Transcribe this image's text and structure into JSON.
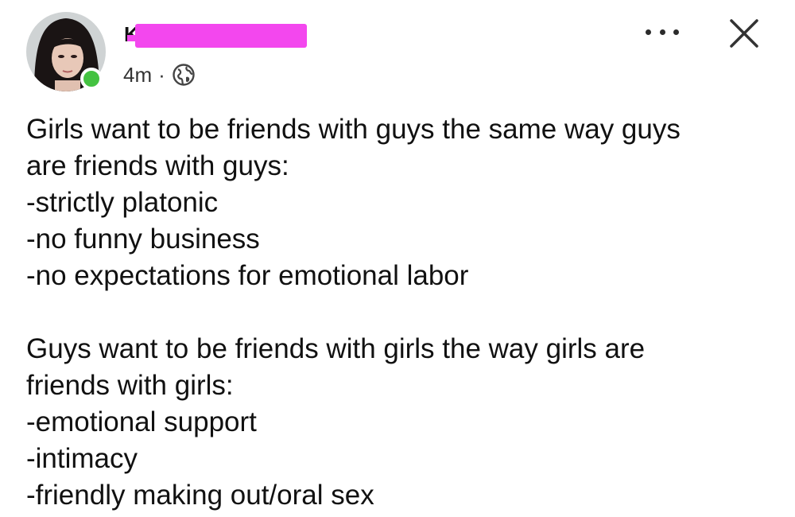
{
  "post": {
    "author_visible_initial": "K",
    "time": "4m",
    "separator": "·",
    "privacy_icon": "globe-icon",
    "more_icon": "more-options-icon",
    "close_icon": "close-icon",
    "paragraph1": {
      "lines": [
        "Girls want to be friends with guys the same way guys",
        "are friends with guys:",
        "-strictly platonic",
        "-no funny business",
        "-no expectations for emotional labor"
      ]
    },
    "paragraph2": {
      "lines": [
        "Guys want to be friends with girls the way girls are",
        "friends with girls:",
        "-emotional support",
        "-intimacy",
        "-friendly making out/oral sex"
      ]
    }
  },
  "colors": {
    "redaction": "#f347ee",
    "online": "#44c241",
    "text": "#111111"
  }
}
